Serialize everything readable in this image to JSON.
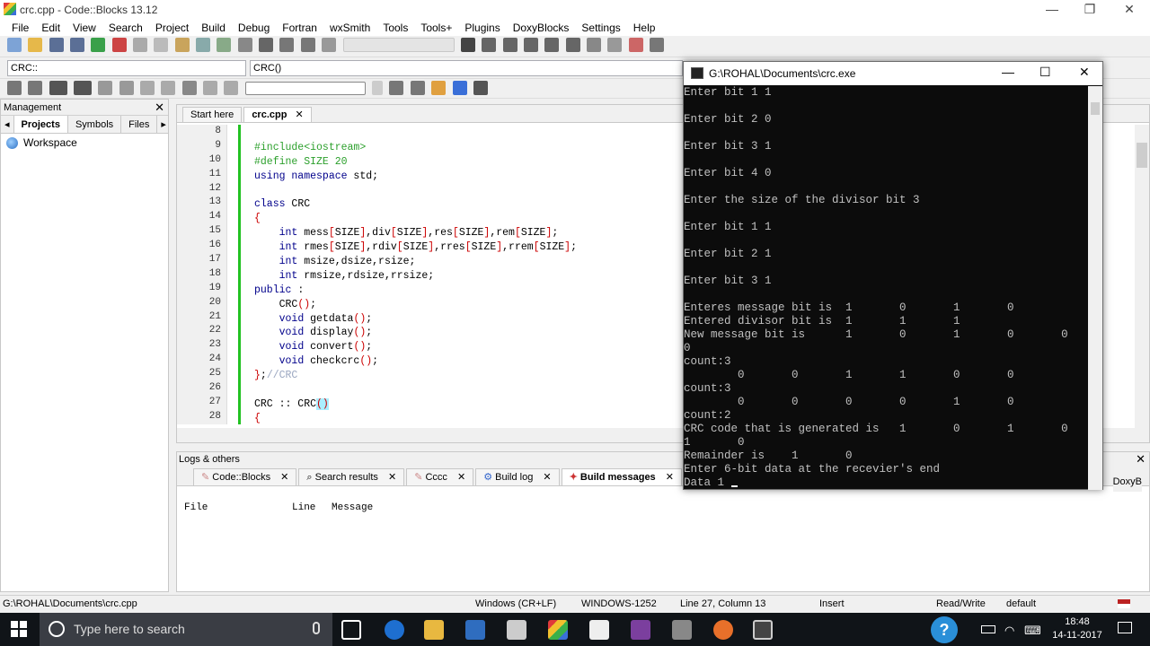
{
  "window": {
    "title": "crc.cpp - Code::Blocks 13.12",
    "min": "—",
    "max": "❐",
    "close": "✕"
  },
  "menu": [
    "File",
    "Edit",
    "View",
    "Search",
    "Project",
    "Build",
    "Debug",
    "Fortran",
    "wxSmith",
    "Tools",
    "Tools+",
    "Plugins",
    "DoxyBlocks",
    "Settings",
    "Help"
  ],
  "toolbar": {
    "scope_combo": "CRC::",
    "function_combo": "CRC()"
  },
  "management": {
    "title": "Management",
    "tabs": [
      "Projects",
      "Symbols",
      "Files"
    ],
    "tree_root": "Workspace"
  },
  "editor": {
    "tabs": [
      "Start here",
      "crc.cpp"
    ],
    "line_numbers": [
      "8",
      "9",
      "10",
      "11",
      "12",
      "13",
      "14",
      "15",
      "16",
      "17",
      "18",
      "19",
      "20",
      "21",
      "22",
      "23",
      "24",
      "25",
      "26",
      "27",
      "28"
    ]
  },
  "console": {
    "title": "G:\\ROHAL\\Documents\\crc.exe",
    "lines": [
      "Enter bit 1 1",
      "",
      "Enter bit 2 0",
      "",
      "Enter bit 3 1",
      "",
      "Enter bit 4 0",
      "",
      "Enter the size of the divisor bit 3",
      "",
      "Enter bit 1 1",
      "",
      "Enter bit 2 1",
      "",
      "Enter bit 3 1",
      "",
      "Enteres message bit is  1       0       1       0",
      "Entered divisor bit is  1       1       1",
      "New message bit is      1       0       1       0       0",
      "0",
      "count:3",
      "        0       0       1       1       0       0",
      "count:3",
      "        0       0       0       0       1       0",
      "count:2",
      "CRC code that is generated is   1       0       1       0",
      "1       0",
      "Remainder is    1       0",
      "Enter 6-bit data at the recevier's end",
      "Data 1 "
    ]
  },
  "logs": {
    "title": "Logs & others",
    "tabs": [
      "Code::Blocks",
      "Search results",
      "Cccc",
      "Build log",
      "Build messages"
    ],
    "right_tab": "DoxyB",
    "columns": [
      "File",
      "Line",
      "Message"
    ]
  },
  "status": {
    "path": "G:\\ROHAL\\Documents\\crc.cpp",
    "eol": "Windows (CR+LF)",
    "encoding": "WINDOWS-1252",
    "position": "Line 27, Column 13",
    "mode": "Insert",
    "access": "Read/Write",
    "profile": "default"
  },
  "taskbar": {
    "search_placeholder": "Type here to search",
    "time": "18:48",
    "date": "14-11-2017"
  }
}
